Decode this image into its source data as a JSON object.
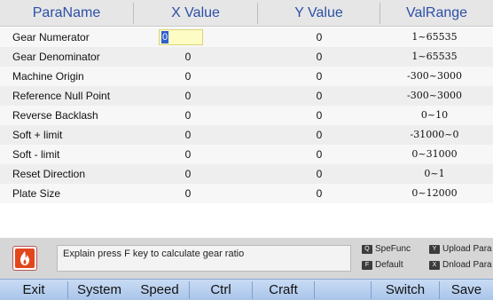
{
  "header": {
    "name": "ParaName",
    "x": "X Value",
    "y": "Y Value",
    "range": "ValRange"
  },
  "rows": [
    {
      "name": "Gear Numerator",
      "x": "0",
      "y": "0",
      "range": "1~65535"
    },
    {
      "name": "Gear Denominator",
      "x": "0",
      "y": "0",
      "range": "1~65535"
    },
    {
      "name": "Machine Origin",
      "x": "0",
      "y": "0",
      "range": "-300~3000"
    },
    {
      "name": "Reference Null Point",
      "x": "0",
      "y": "0",
      "range": "-300~3000"
    },
    {
      "name": "Reverse Backlash",
      "x": "0",
      "y": "0",
      "range": "0~10"
    },
    {
      "name": "Soft + limit",
      "x": "0",
      "y": "0",
      "range": "-31000~0"
    },
    {
      "name": "Soft - limit",
      "x": "0",
      "y": "0",
      "range": "0~31000"
    },
    {
      "name": "Reset Direction",
      "x": "0",
      "y": "0",
      "range": "0~1"
    },
    {
      "name": "Plate Size",
      "x": "0",
      "y": "0",
      "range": "0~12000"
    }
  ],
  "info": {
    "icon": "fire-icon",
    "text": "Explain press F key to calculate gear ratio"
  },
  "hints": [
    {
      "key": "Q",
      "label": "SpeFunc"
    },
    {
      "key": "Y",
      "label": "Upload Para"
    },
    {
      "key": "F",
      "label": "Default"
    },
    {
      "key": "X",
      "label": "Dnload Para"
    }
  ],
  "fkeys": [
    "Exit",
    "System",
    "Speed",
    "Ctrl",
    "Craft",
    "",
    "Switch",
    "Save"
  ],
  "colors": {
    "header_text": "#2c4fa8",
    "edit_bg": "#fdfcc4",
    "caret": "#2f5fd0",
    "fbar": "#b9d1f0"
  }
}
